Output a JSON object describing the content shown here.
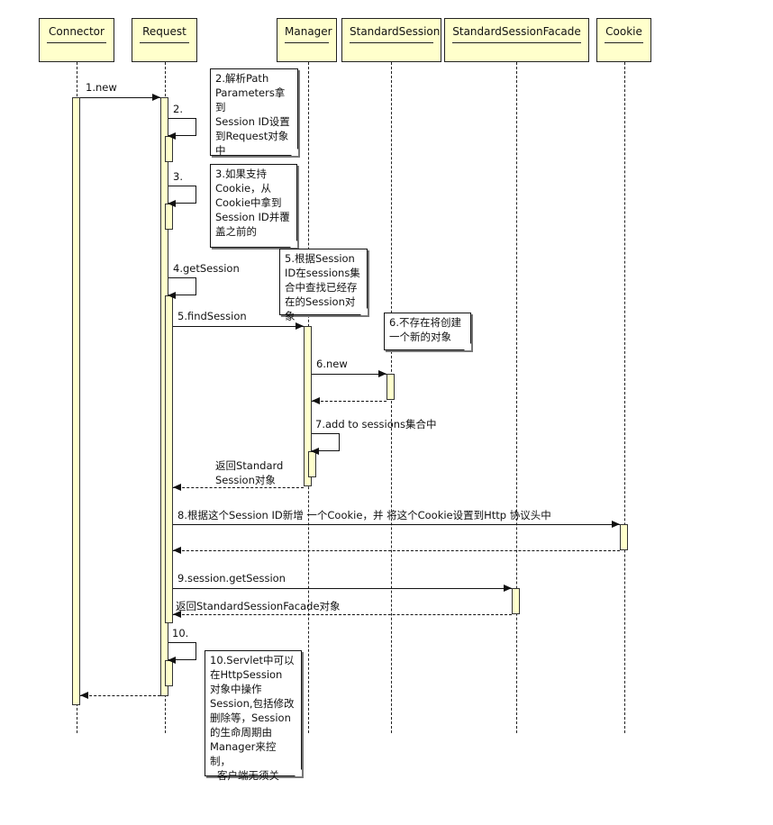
{
  "participants": [
    {
      "name": "Connector"
    },
    {
      "name": "Request"
    },
    {
      "name": "Manager"
    },
    {
      "name": "StandardSession"
    },
    {
      "name": "StandardSessionFacade"
    },
    {
      "name": "Cookie"
    }
  ],
  "messages": {
    "m1": "1.new",
    "m2": "2.",
    "m3": "3.",
    "m4": "4.getSession",
    "m5": "5.findSession",
    "m6": "6.new",
    "m7": "7.add to sessions集合中",
    "r7_line1": "返回Standard",
    "r7_line2": "Session对象",
    "m8": "8.根据这个Session ID新增 一个Cookie，并 将这个Cookie设置到Http 协议头中",
    "m9": "9.session.getSession",
    "r9": "返回StandardSessionFacade对象",
    "m10": "10."
  },
  "notes": {
    "n2": [
      "2.解析Path",
      "Parameters拿到",
      "Session ID设置",
      "到Request对象",
      "中"
    ],
    "n3": [
      "3.如果支持",
      "Cookie，从",
      "Cookie中拿到",
      "Session ID并覆",
      "盖之前的"
    ],
    "n5": [
      "5.根据Session",
      "ID在sessions集",
      "合中查找已经存",
      "在的Session对象"
    ],
    "n6": [
      "6.不存在将创建",
      "一个新的对象"
    ],
    "n10": [
      "10.Servlet中可以",
      "在HttpSession",
      "对象中操作",
      "Session,包括修改",
      "删除等，Session",
      "的生命周期由",
      "Manager来控制，",
      "客户端无须关"
    ]
  },
  "colors": {
    "activation_fill": "#ffffcc",
    "line": "#111111"
  }
}
